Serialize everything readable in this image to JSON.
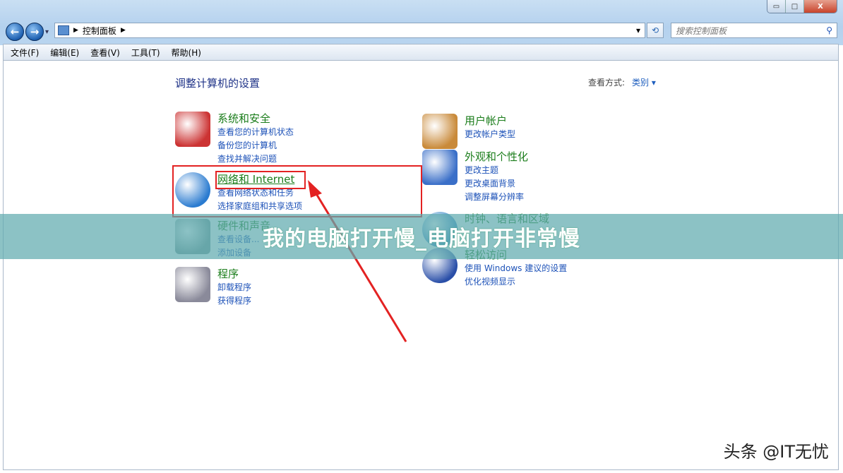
{
  "window": {
    "min": "▭",
    "max": "□",
    "close": "X"
  },
  "address": {
    "crumb": "控制面板",
    "dropdown": "▾",
    "refresh": "⟲"
  },
  "search": {
    "placeholder": "搜索控制面板",
    "icon": "search-icon"
  },
  "menu": [
    "文件(F)",
    "编辑(E)",
    "查看(V)",
    "工具(T)",
    "帮助(H)"
  ],
  "main": {
    "title": "调整计算机的设置",
    "view_by_label": "查看方式:",
    "view_by_value": "类别 ▾",
    "categories": [
      {
        "title": "系统和安全",
        "links": [
          "查看您的计算机状态",
          "备份您的计算机",
          "查找并解决问题"
        ]
      },
      {
        "title": "网络和 Internet",
        "links": [
          "查看网络状态和任务",
          "选择家庭组和共享选项"
        ]
      },
      {
        "title": "硬件和声音",
        "links": [
          "查看设备...",
          "添加设备"
        ]
      },
      {
        "title": "程序",
        "links": [
          "卸载程序",
          "获得程序"
        ]
      },
      {
        "title": "用户帐户",
        "links": [
          "更改帐户类型"
        ]
      },
      {
        "title": "外观和个性化",
        "links": [
          "更改主题",
          "更改桌面背景",
          "调整屏幕分辨率"
        ]
      },
      {
        "title": "时钟、语言和区域",
        "links": []
      },
      {
        "title": "轻松访问",
        "links": [
          "使用 Windows 建议的设置",
          "优化视频显示"
        ]
      }
    ]
  },
  "annotation": {
    "color": "#e32222"
  },
  "banner": "我的电脑打开慢_电脑打开非常慢",
  "watermark": "头条 @IT无忧"
}
